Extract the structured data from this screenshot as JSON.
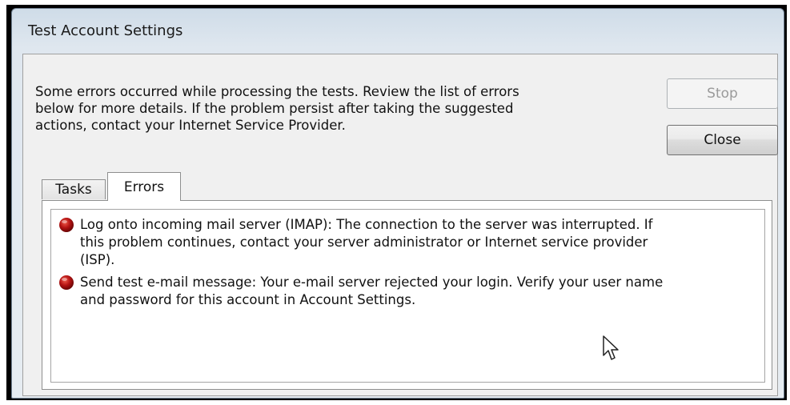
{
  "window": {
    "title": "Test Account Settings"
  },
  "message": {
    "lines": [
      "Some errors occurred while processing the tests. Review the list of errors",
      "below for more details. If the problem persist after taking the suggested",
      "actions, contact your Internet Service Provider."
    ]
  },
  "buttons": {
    "stop": {
      "label": "Stop",
      "state": "disabled"
    },
    "close": {
      "label": "Close"
    }
  },
  "tabs": [
    {
      "label": "Tasks",
      "selected": false
    },
    {
      "label": "Errors",
      "selected": true
    }
  ],
  "errors": [
    {
      "icon": "error-icon",
      "lines": [
        "Log onto incoming mail server (IMAP): The connection to the server was interrupted. If",
        "this problem continues, contact your server administrator or Internet service provider",
        "(ISP)."
      ]
    },
    {
      "icon": "error-icon",
      "lines": [
        "Send test e-mail message: Your e-mail server rejected your login. Verify your user name",
        "and password for this account in Account Settings."
      ]
    }
  ],
  "colors": {
    "error_icon": "#b31212",
    "disabled_text": "#9a9a9a"
  }
}
